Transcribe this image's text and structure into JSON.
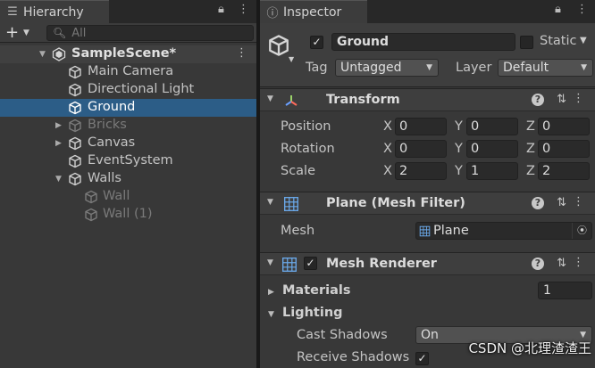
{
  "hierarchy": {
    "tab_label": "Hierarchy",
    "add_label": "+",
    "search_placeholder": "All",
    "scene_name": "SampleScene*",
    "items": [
      {
        "label": "Main Camera"
      },
      {
        "label": "Directional Light"
      },
      {
        "label": "Ground"
      },
      {
        "label": "Bricks"
      },
      {
        "label": "Canvas"
      },
      {
        "label": "EventSystem"
      },
      {
        "label": "Walls"
      },
      {
        "label": "Wall"
      },
      {
        "label": "Wall (1)"
      }
    ]
  },
  "inspector": {
    "tab_label": "Inspector",
    "object_name": "Ground",
    "static_label": "Static",
    "tag_label": "Tag",
    "tag_value": "Untagged",
    "layer_label": "Layer",
    "layer_value": "Default",
    "transform": {
      "title": "Transform",
      "position_label": "Position",
      "rotation_label": "Rotation",
      "scale_label": "Scale",
      "axis_x": "X",
      "axis_y": "Y",
      "axis_z": "Z",
      "position": [
        "0",
        "0",
        "0"
      ],
      "rotation": [
        "0",
        "0",
        "0"
      ],
      "scale": [
        "2",
        "1",
        "2"
      ]
    },
    "mesh_filter": {
      "title": "Plane (Mesh Filter)",
      "mesh_label": "Mesh",
      "mesh_value": "Plane"
    },
    "mesh_renderer": {
      "title": "Mesh Renderer",
      "materials_label": "Materials",
      "materials_count": "1",
      "lighting_label": "Lighting",
      "cast_shadows_label": "Cast Shadows",
      "cast_shadows_value": "On",
      "receive_shadows_label": "Receive Shadows"
    }
  },
  "watermark": "CSDN @北理渣渣王",
  "colors": {
    "selection": "#2c5d87",
    "panel_bg": "#383838",
    "header_bg": "#3e3e3e",
    "field_bg": "#2a2a2a"
  }
}
